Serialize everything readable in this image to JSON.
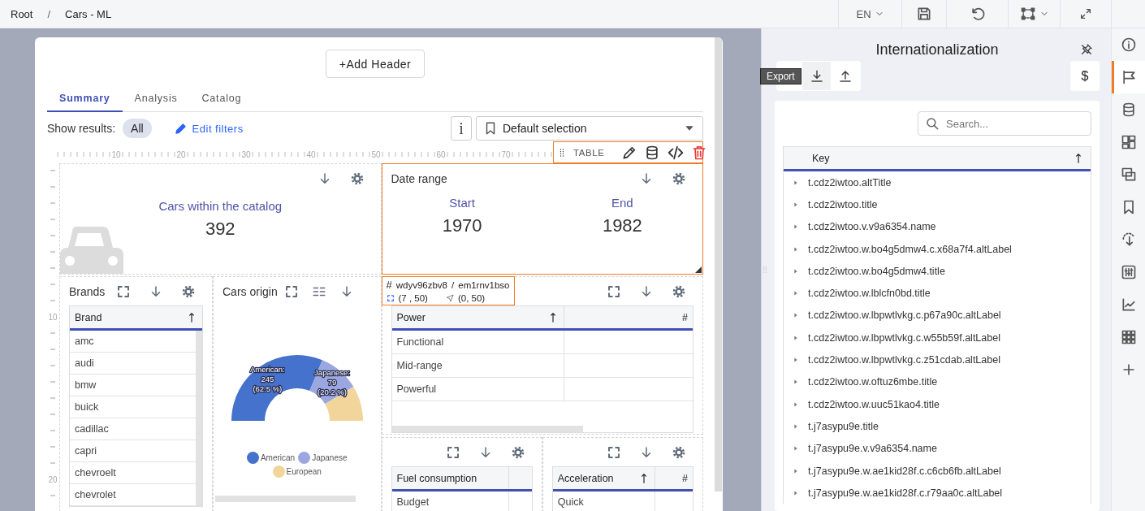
{
  "breadcrumb": [
    {
      "label": "Root"
    },
    {
      "label": "Cars - ML"
    }
  ],
  "breadcrumb_separator": "/",
  "toolbar": {
    "language": "EN"
  },
  "canvas": {
    "add_header": "+Add Header",
    "tabs": [
      {
        "label": "Summary",
        "selected": true
      },
      {
        "label": "Analysis",
        "selected": false
      },
      {
        "label": "Catalog",
        "selected": false
      }
    ],
    "filter_bar": {
      "label": "Show results:",
      "chip": "All",
      "edit_link": "Edit filters",
      "info_button": "i",
      "selection": "Default selection"
    },
    "ruler": {
      "x_labels": [
        "10",
        "20",
        "30",
        "40",
        "50",
        "60",
        "70"
      ],
      "y_labels": [
        "10",
        "20"
      ]
    },
    "widget_toolbar": {
      "label": "TABLE"
    },
    "selection_info": {
      "hash": "#",
      "widget_id": "wdyv96zbv8",
      "separator": "/",
      "parent_id": "em1rnv1bso",
      "size": "(7 , 50)",
      "position": "(0, 50)"
    },
    "kpi_widget": {
      "selected": false,
      "title": "Cars within the catalog",
      "value": "392"
    },
    "date_widget": {
      "selected": true,
      "title": "Date range",
      "start_label": "Start",
      "start": "1970",
      "end_label": "End",
      "end": "1982"
    },
    "brands_widget": {
      "selected": false,
      "title": "Brands",
      "columns": [
        {
          "label": "Brand",
          "sorted": true
        }
      ],
      "rows": [
        "amc",
        "audi",
        "bmw",
        "buick",
        "cadillac",
        "capri",
        "chevroelt",
        "chevrolet"
      ]
    },
    "origin_widget": {
      "selected": false,
      "title": "Cars origin",
      "chart_data": {
        "type": "donut",
        "categories": [
          "American",
          "Japanese",
          "European"
        ],
        "values": [
          62.5,
          20.2,
          17.3
        ],
        "legend": true,
        "colors": [
          "#4472cc",
          "#9ba7e0",
          "#f2d59b"
        ],
        "data_labels": true,
        "value_labels": [
          [
            "American:",
            "245",
            "(62.5 %)"
          ],
          [
            "Japanese:",
            "79",
            "(20.2 %)"
          ],
          null
        ]
      }
    },
    "power_widget": {
      "selected": false,
      "columns": [
        {
          "label": "Power",
          "sorted": true
        },
        {
          "label": "#",
          "sorted": false
        }
      ],
      "rows": [
        "Functional",
        "Mid-range",
        "Powerful"
      ]
    },
    "fuel_widget": {
      "selected": false,
      "columns": [
        {
          "label": "Fuel consumption",
          "sorted": false
        },
        {
          "sorted": false
        }
      ],
      "rows": [
        "Budget"
      ]
    },
    "acceleration_widget": {
      "selected": false,
      "columns": [
        {
          "label": "Acceleration",
          "sorted": true
        },
        {
          "label": "#",
          "sorted": false
        }
      ],
      "rows": [
        "Quick"
      ]
    }
  },
  "right_panel": {
    "title": "Internationalization",
    "tooltip": "Export",
    "currency_button": "$",
    "search_placeholder": "Search...",
    "column": {
      "label": "Key",
      "sorted": true
    },
    "rows": [
      {
        "key": "t.cdz2iwtoo.altTitle",
        "expanded": false
      },
      {
        "key": "t.cdz2iwtoo.title",
        "expanded": false
      },
      {
        "key": "t.cdz2iwtoo.v.v9a6354.name",
        "expanded": false
      },
      {
        "key": "t.cdz2iwtoo.w.bo4g5dmw4.c.x68a7f4.altLabel",
        "expanded": false
      },
      {
        "key": "t.cdz2iwtoo.w.bo4g5dmw4.title",
        "expanded": false
      },
      {
        "key": "t.cdz2iwtoo.w.lblcfn0bd.title",
        "expanded": false
      },
      {
        "key": "t.cdz2iwtoo.w.lbpwtlvkg.c.p67a90c.altLabel",
        "expanded": false
      },
      {
        "key": "t.cdz2iwtoo.w.lbpwtlvkg.c.w55b59f.altLabel",
        "expanded": false
      },
      {
        "key": "t.cdz2iwtoo.w.lbpwtlvkg.c.z51cdab.altLabel",
        "expanded": false
      },
      {
        "key": "t.cdz2iwtoo.w.oftuz6mbe.title",
        "expanded": false
      },
      {
        "key": "t.cdz2iwtoo.w.uuc51kao4.title",
        "expanded": false
      },
      {
        "key": "t.j7asypu9e.title",
        "expanded": false
      },
      {
        "key": "t.j7asypu9e.v.v9a6354.name",
        "expanded": false
      },
      {
        "key": "t.j7asypu9e.w.ae1kid28f.c.c6cb6fb.altLabel",
        "expanded": false
      },
      {
        "key": "t.j7asypu9e.w.ae1kid28f.c.r79aa0c.altLabel",
        "expanded": false
      }
    ]
  },
  "rail": [
    {
      "kind": "info",
      "selected": false
    },
    {
      "kind": "flag",
      "selected": true
    },
    {
      "kind": "database",
      "selected": false
    },
    {
      "kind": "layout",
      "selected": false
    },
    {
      "kind": "copies",
      "selected": false
    },
    {
      "kind": "bookmark",
      "selected": false
    },
    {
      "kind": "rotate",
      "selected": false
    },
    {
      "kind": "sliders",
      "selected": false
    },
    {
      "kind": "chart",
      "selected": false
    },
    {
      "kind": "grid",
      "selected": false
    },
    {
      "kind": "plus",
      "selected": false
    }
  ]
}
